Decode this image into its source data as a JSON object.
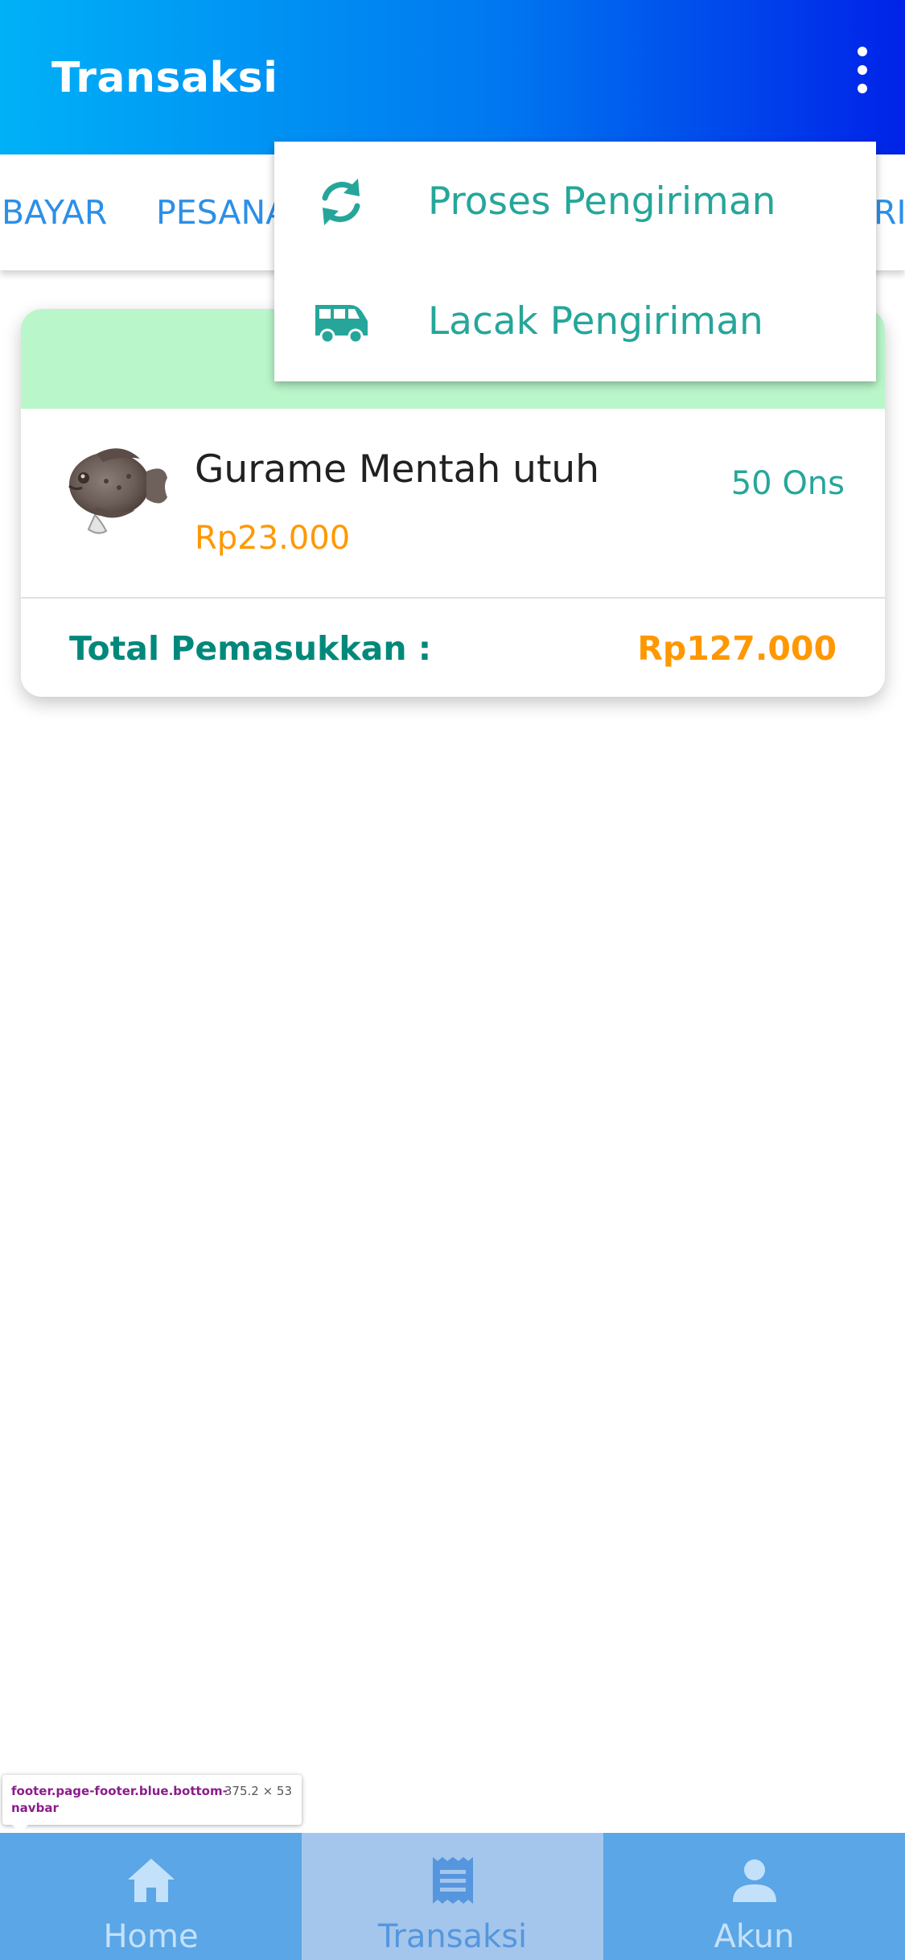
{
  "header": {
    "title": "Transaksi"
  },
  "tabs": [
    {
      "label": "BAYAR"
    },
    {
      "label": "PESANAN"
    },
    {
      "label": "RI"
    }
  ],
  "dropdown": {
    "items": [
      {
        "label": "Proses Pengiriman",
        "icon": "sync-icon"
      },
      {
        "label": "Lacak Pengiriman",
        "icon": "shuttle-van-icon"
      }
    ]
  },
  "order": {
    "band_color": "#b9f6ca",
    "product": {
      "name": "Gurame Mentah utuh",
      "price": "Rp23.000",
      "quantity": "50 Ons"
    },
    "total_label": "Total Pemasukkan :",
    "total_value": "Rp127.000"
  },
  "inspector_tooltip": {
    "selector": "footer.page-footer.blue.bottom-navbar",
    "size": "375.2 × 53"
  },
  "bottom_nav": {
    "items": [
      {
        "label": "Home",
        "icon": "home-icon"
      },
      {
        "label": "Transaksi",
        "icon": "receipt-icon",
        "active": true
      },
      {
        "label": "Akun",
        "icon": "person-icon"
      }
    ]
  },
  "colors": {
    "accent_teal": "#26a69a",
    "price_orange": "#ff9800",
    "tab_blue": "#2c8fe8",
    "nav_blue": "#5aa6e6"
  }
}
